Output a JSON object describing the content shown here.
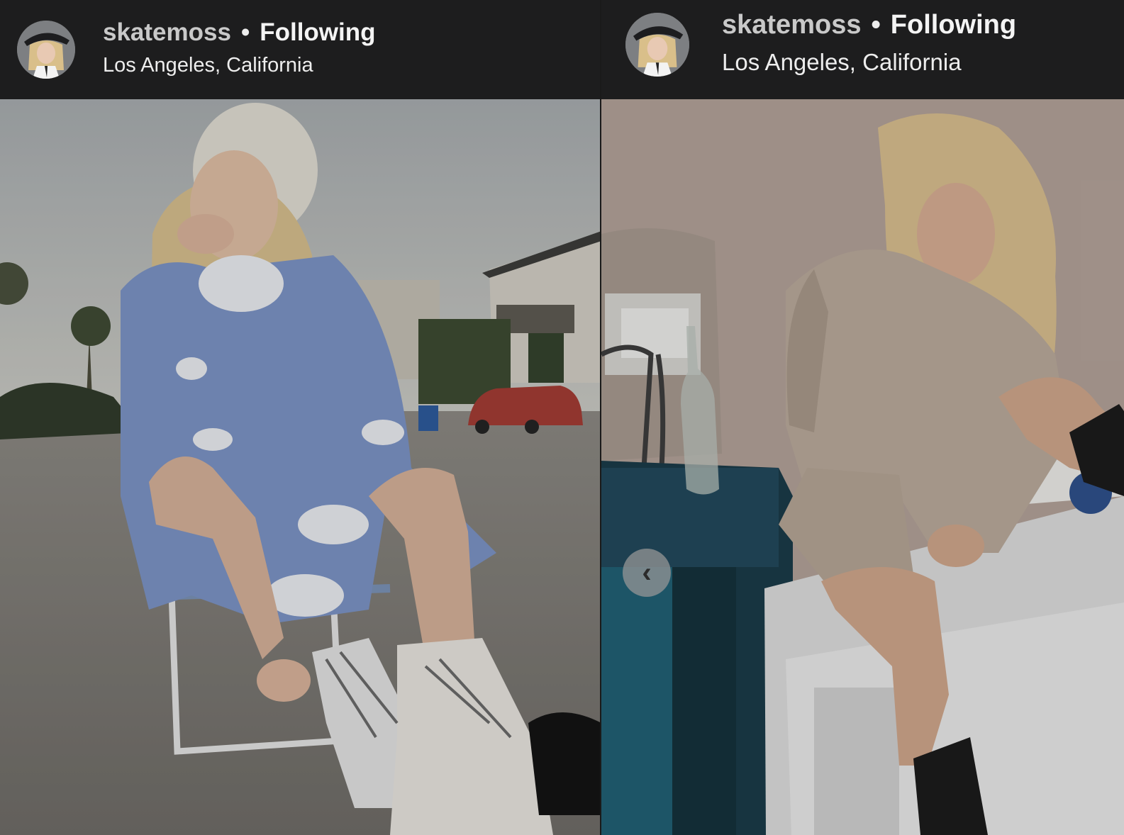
{
  "posts": [
    {
      "username": "skatemoss",
      "separator": "•",
      "follow_status": "Following",
      "location": "Los Angeles, California",
      "avatar_icon": "profile-avatar",
      "photo_description_icon": "photo"
    },
    {
      "username": "skatemoss",
      "separator": "•",
      "follow_status": "Following",
      "location": "Los Angeles, California",
      "avatar_icon": "profile-avatar",
      "photo_description_icon": "photo",
      "prev_button_glyph": "‹"
    }
  ],
  "colors": {
    "header_bg": "#1d1d1e",
    "username": "#c9c9c9",
    "text": "#f2f2f2"
  }
}
